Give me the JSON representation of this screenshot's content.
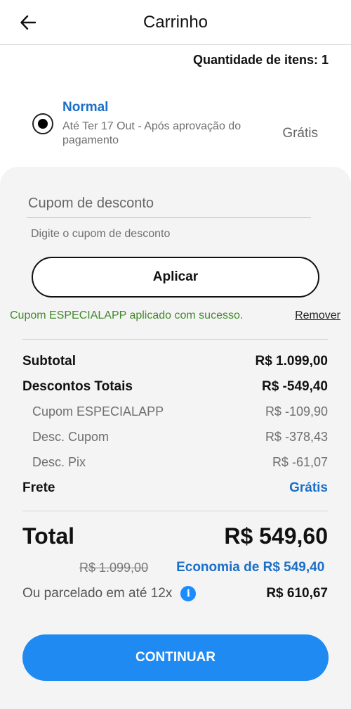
{
  "header": {
    "title": "Carrinho"
  },
  "cart": {
    "quantity_label": "Quantidade de itens: 1"
  },
  "shipping": {
    "name": "Normal",
    "description": "Até Ter 17 Out - Após aprovação do pagamento",
    "price": "Grátis",
    "selected": true
  },
  "coupon": {
    "label": "Cupom de desconto",
    "placeholder": "Digite o cupom de desconto",
    "apply_label": "Aplicar",
    "success_message": "Cupom ESPECIALAPP aplicado com sucesso.",
    "remove_label": "Remover"
  },
  "summary": {
    "subtotal_label": "Subtotal",
    "subtotal_value": "R$ 1.099,00",
    "discounts_label": "Descontos Totais",
    "discounts_value": "R$ -549,40",
    "discount_items": [
      {
        "label": "Cupom ESPECIALAPP",
        "value": "R$ -109,90"
      },
      {
        "label": "Desc. Cupom",
        "value": "R$ -378,43"
      },
      {
        "label": "Desc. Pix",
        "value": "R$ -61,07"
      }
    ],
    "shipping_label": "Frete",
    "shipping_value": "Grátis",
    "total_label": "Total",
    "total_value": "R$ 549,60",
    "original_price": "R$ 1.099,00",
    "savings": "Economia de R$ 549,40",
    "installments_label": "Ou parcelado em até 12x",
    "installments_value": "R$ 610,67"
  },
  "actions": {
    "continue_label": "CONTINUAR"
  },
  "colors": {
    "accent": "#1f8af2",
    "link_blue": "#1a6fc8",
    "success": "#3f8a2a",
    "panel": "#f4f4f4"
  },
  "icons": {
    "back": "arrow-left-icon",
    "info": "info-icon"
  }
}
